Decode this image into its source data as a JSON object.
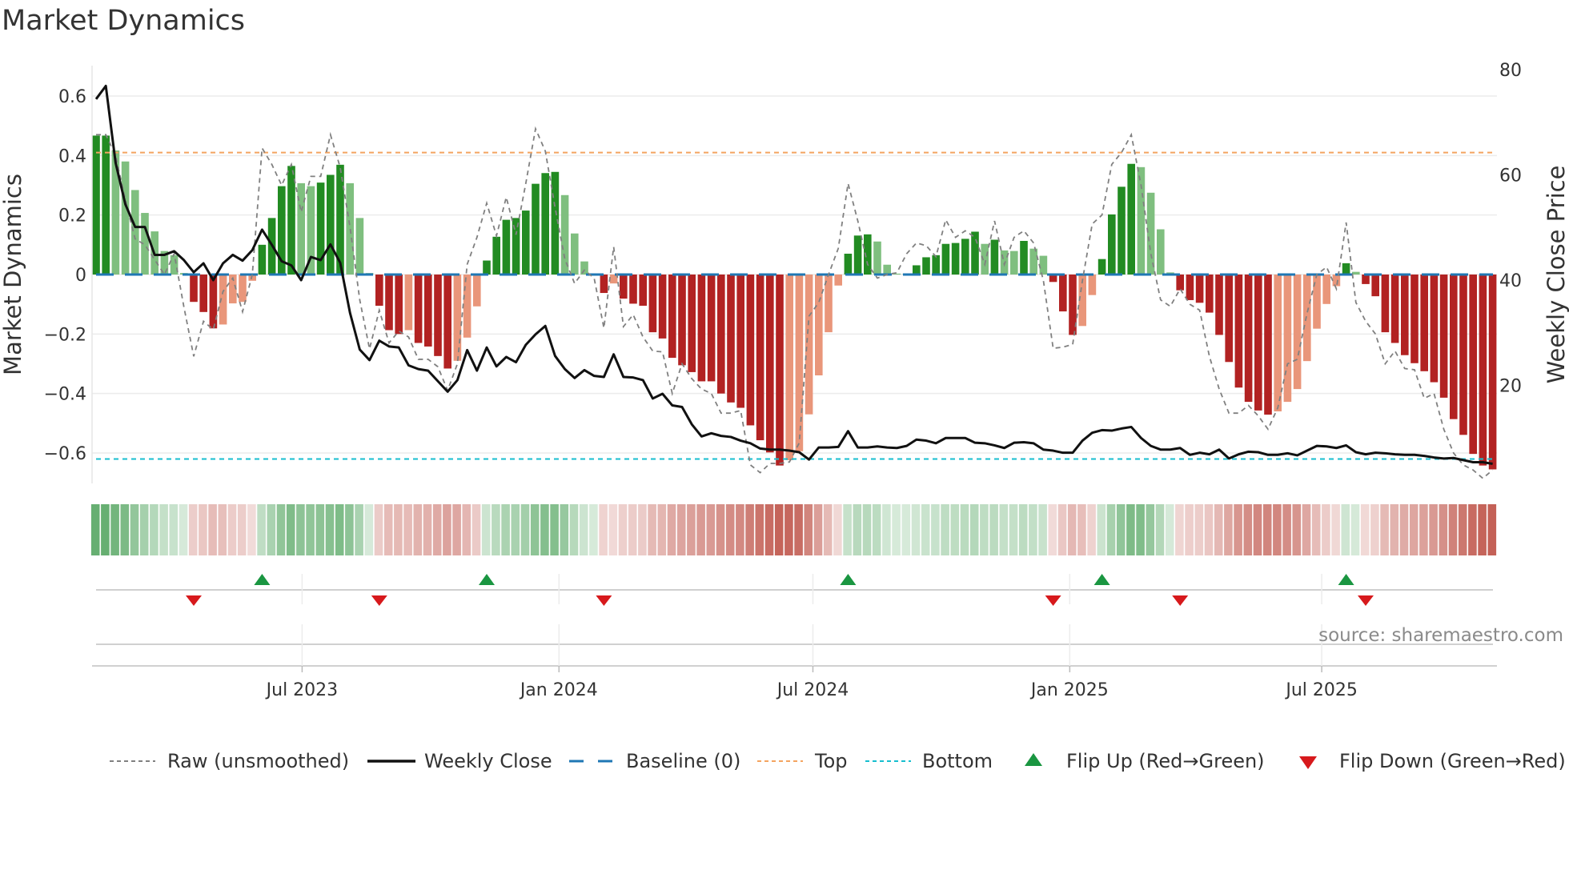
{
  "title": "Market Dynamics",
  "source": "source: sharemaestro.com",
  "colors": {
    "strong_up": "#228b22",
    "weak_up": "#7fbf7f",
    "strong_down": "#b22222",
    "weak_down": "#e9967a",
    "raw": "#808080",
    "close": "#111111",
    "baseline": "#1f77b4",
    "top": "#f4a460",
    "bottom": "#17becf",
    "flip_up": "#1a9641",
    "flip_down": "#d7191c"
  },
  "chart_data": {
    "type": "bar",
    "title": "Market Dynamics",
    "ylabel": "Market Dynamics",
    "y2label": "Weekly Close Price",
    "ylim": [
      -0.7,
      0.7
    ],
    "y2lim": [
      0,
      80
    ],
    "y_ticks": [
      "0.6",
      "0.4",
      "0.2",
      "0",
      "−0.2",
      "−0.4",
      "−0.6"
    ],
    "y_tick_values": [
      0.6,
      0.4,
      0.2,
      0,
      -0.2,
      -0.4,
      -0.6
    ],
    "y2_ticks": [
      "80",
      "60",
      "40",
      "20"
    ],
    "y2_tick_values": [
      80,
      60,
      40,
      20
    ],
    "x_unit": "week index",
    "x_ticks": [
      {
        "label": "Jul 2023",
        "week": 21.1
      },
      {
        "label": "Jan 2024",
        "week": 47.4
      },
      {
        "label": "Jul 2024",
        "week": 73.4
      },
      {
        "label": "Jan 2025",
        "week": 99.7
      },
      {
        "label": "Jul 2025",
        "week": 125.5
      }
    ],
    "top_level": 0.41,
    "bottom_level": -0.62,
    "baseline": 0,
    "grid": true,
    "legend_position": "bottom",
    "shade_key": {
      "G": "strong_up",
      "g": "weak_up",
      "R": "strong_down",
      "r": "weak_down"
    },
    "smoothed": [
      0.467,
      0.467,
      0.417,
      0.38,
      0.284,
      0.207,
      0.145,
      0.079,
      0.065,
      0.005,
      -0.092,
      -0.126,
      -0.181,
      -0.168,
      -0.097,
      -0.092,
      -0.021,
      0.1,
      0.19,
      0.297,
      0.365,
      0.307,
      0.297,
      0.309,
      0.335,
      0.369,
      0.307,
      0.19,
      0.005,
      -0.105,
      -0.187,
      -0.2,
      -0.187,
      -0.23,
      -0.242,
      -0.274,
      -0.316,
      -0.29,
      -0.212,
      -0.107,
      0.047,
      0.127,
      0.184,
      0.19,
      0.215,
      0.305,
      0.341,
      0.345,
      0.267,
      0.138,
      0.044,
      0.003,
      -0.062,
      -0.03,
      -0.081,
      -0.098,
      -0.105,
      -0.194,
      -0.215,
      -0.28,
      -0.305,
      -0.328,
      -0.359,
      -0.359,
      -0.4,
      -0.43,
      -0.448,
      -0.507,
      -0.557,
      -0.598,
      -0.642,
      -0.624,
      -0.594,
      -0.47,
      -0.339,
      -0.194,
      -0.037,
      0.07,
      0.131,
      0.135,
      0.111,
      0.033,
      0.003,
      0.003,
      0.031,
      0.058,
      0.065,
      0.103,
      0.106,
      0.12,
      0.144,
      0.103,
      0.117,
      0.081,
      0.079,
      0.113,
      0.087,
      0.063,
      -0.025,
      -0.124,
      -0.203,
      -0.173,
      -0.069,
      0.052,
      0.202,
      0.295,
      0.372,
      0.361,
      0.275,
      0.152,
      0.007,
      -0.053,
      -0.086,
      -0.095,
      -0.128,
      -0.203,
      -0.294,
      -0.38,
      -0.428,
      -0.457,
      -0.471,
      -0.46,
      -0.428,
      -0.385,
      -0.291,
      -0.182,
      -0.099,
      -0.039,
      0.038,
      0.009,
      -0.032,
      -0.073,
      -0.194,
      -0.23,
      -0.271,
      -0.298,
      -0.325,
      -0.362,
      -0.414,
      -0.486,
      -0.539,
      -0.603,
      -0.642,
      -0.655
    ],
    "shades": [
      "G",
      "G",
      "g",
      "g",
      "g",
      "g",
      "g",
      "g",
      "g",
      "g",
      "R",
      "R",
      "R",
      "r",
      "r",
      "r",
      "r",
      "G",
      "G",
      "G",
      "G",
      "g",
      "g",
      "G",
      "G",
      "G",
      "g",
      "g",
      "g",
      "R",
      "R",
      "R",
      "r",
      "R",
      "R",
      "R",
      "R",
      "r",
      "r",
      "r",
      "G",
      "G",
      "G",
      "G",
      "G",
      "G",
      "G",
      "G",
      "g",
      "g",
      "g",
      "g",
      "R",
      "r",
      "R",
      "R",
      "R",
      "R",
      "R",
      "R",
      "R",
      "R",
      "R",
      "R",
      "R",
      "R",
      "R",
      "R",
      "R",
      "R",
      "R",
      "r",
      "r",
      "r",
      "r",
      "r",
      "r",
      "G",
      "G",
      "G",
      "g",
      "g",
      "g",
      "G",
      "G",
      "G",
      "G",
      "G",
      "G",
      "G",
      "G",
      "g",
      "G",
      "g",
      "g",
      "G",
      "g",
      "g",
      "R",
      "R",
      "R",
      "r",
      "r",
      "G",
      "G",
      "G",
      "G",
      "g",
      "g",
      "g",
      "g",
      "R",
      "R",
      "R",
      "R",
      "R",
      "R",
      "R",
      "R",
      "R",
      "R",
      "r",
      "r",
      "r",
      "r",
      "r",
      "r",
      "r",
      "G",
      "g",
      "R",
      "R",
      "R",
      "R",
      "R",
      "R",
      "R",
      "R",
      "R",
      "R",
      "R",
      "R",
      "R",
      "R"
    ],
    "raw": [
      0.47,
      0.47,
      0.4,
      0.25,
      0.12,
      0.1,
      0.05,
      0.0,
      0.07,
      -0.11,
      -0.275,
      -0.157,
      -0.185,
      -0.057,
      -0.012,
      -0.125,
      0.0,
      0.425,
      0.37,
      0.3,
      0.37,
      0.21,
      0.33,
      0.33,
      0.47,
      0.36,
      0.16,
      -0.085,
      -0.25,
      -0.12,
      -0.23,
      -0.19,
      -0.21,
      -0.285,
      -0.285,
      -0.31,
      -0.39,
      -0.3,
      0.034,
      0.125,
      0.24,
      0.13,
      0.26,
      0.134,
      0.306,
      0.49,
      0.415,
      0.225,
      0.052,
      -0.03,
      0.015,
      -0.012,
      -0.18,
      0.093,
      -0.175,
      -0.135,
      -0.21,
      -0.257,
      -0.26,
      -0.4,
      -0.3,
      -0.35,
      -0.385,
      -0.4,
      -0.466,
      -0.466,
      -0.457,
      -0.64,
      -0.666,
      -0.635,
      -0.635,
      -0.63,
      -0.566,
      -0.14,
      -0.094,
      0.0,
      0.088,
      0.306,
      0.18,
      0.034,
      -0.012,
      0.0,
      0.006,
      0.07,
      0.106,
      0.097,
      0.06,
      0.184,
      0.125,
      0.147,
      0.125,
      0.034,
      0.18,
      0.034,
      0.125,
      0.147,
      0.106,
      -0.02,
      -0.248,
      -0.244,
      -0.235,
      -0.02,
      0.17,
      0.2,
      0.37,
      0.41,
      0.47,
      0.3,
      0.07,
      -0.085,
      -0.107,
      -0.048,
      -0.1,
      -0.12,
      -0.275,
      -0.385,
      -0.466,
      -0.466,
      -0.44,
      -0.475,
      -0.52,
      -0.448,
      -0.3,
      -0.285,
      -0.13,
      0.0,
      0.025,
      -0.048,
      0.175,
      -0.094,
      -0.157,
      -0.2,
      -0.3,
      -0.257,
      -0.316,
      -0.32,
      -0.416,
      -0.4,
      -0.52,
      -0.6,
      -0.64,
      -0.657,
      -0.685,
      -0.657
    ],
    "weekly_close": [
      74.4,
      76.9,
      62.3,
      54.4,
      50.1,
      50.1,
      44.8,
      44.8,
      45.5,
      43.8,
      41.5,
      43.2,
      40,
      43.2,
      44.8,
      43.7,
      45.7,
      49.6,
      46.7,
      43.6,
      42.8,
      40,
      44.4,
      43.8,
      46.8,
      43.3,
      33.8,
      26.8,
      24.8,
      28.5,
      27.4,
      27.2,
      23.8,
      23.1,
      22.8,
      20.8,
      18.8,
      21.0,
      26.7,
      22.8,
      27.2,
      23.6,
      25.4,
      24.4,
      27.7,
      29.7,
      31.3,
      25.6,
      23.1,
      21.4,
      22.9,
      21.8,
      21.6,
      25.9,
      21.6,
      21.5,
      21.0,
      17.5,
      18.4,
      16.2,
      15.9,
      12.6,
      10.3,
      10.9,
      10.4,
      10.2,
      9.5,
      9.0,
      8.0,
      7.8,
      7.8,
      7.6,
      7.3,
      5.9,
      8.2,
      8.2,
      8.3,
      11.3,
      8.2,
      8.2,
      8.4,
      8.2,
      8.1,
      8.5,
      9.7,
      9.5,
      9.0,
      10.0,
      10.0,
      10.0,
      9.1,
      9.0,
      8.6,
      8.1,
      9.1,
      9.2,
      9.0,
      7.8,
      7.6,
      7.2,
      7.2,
      9.5,
      11.0,
      11.5,
      11.4,
      11.8,
      12.1,
      10.0,
      8.5,
      7.8,
      7.8,
      8.1,
      6.8,
      7.2,
      6.9,
      7.8,
      6.1,
      6.9,
      7.4,
      7.3,
      6.8,
      6.8,
      7.1,
      6.7,
      7.6,
      8.5,
      8.4,
      8.1,
      8.6,
      7.3,
      6.9,
      7.2,
      7.1,
      6.9,
      6.8,
      6.8,
      6.6,
      6.3,
      6.1,
      6.2,
      5.8,
      5.4,
      5.4,
      5.1
    ],
    "flip_up_weeks": [
      17,
      40,
      77,
      103,
      128
    ],
    "flip_down_weeks": [
      10,
      29,
      52,
      98,
      111,
      130
    ],
    "legend": [
      {
        "key": "raw",
        "label": "Raw (unsmoothed)"
      },
      {
        "key": "close",
        "label": "Weekly Close"
      },
      {
        "key": "baseline",
        "label": "Baseline (0)"
      },
      {
        "key": "top",
        "label": "Top"
      },
      {
        "key": "bottom",
        "label": "Bottom"
      },
      {
        "key": "flip_up",
        "label": "Flip Up (Red→Green)"
      },
      {
        "key": "flip_down",
        "label": "Flip Down (Green→Red)"
      }
    ]
  }
}
